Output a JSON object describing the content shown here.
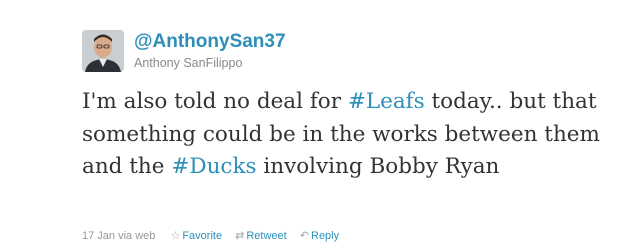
{
  "tweet": {
    "handle": "@AnthonySan37",
    "full_name": "Anthony SanFilippo",
    "avatar_icon": "profile-photo",
    "text_segments": [
      {
        "text": "I'm also told no deal for ",
        "hashtag": false
      },
      {
        "text": "#Leafs",
        "hashtag": true
      },
      {
        "text": " today.. but that something could be in the works between them and the ",
        "hashtag": false
      },
      {
        "text": "#Ducks",
        "hashtag": true
      },
      {
        "text": " involving Bobby Ryan",
        "hashtag": false
      }
    ],
    "timestamp": "17 Jan via web",
    "actions": {
      "favorite": {
        "label": "Favorite",
        "icon": "star-icon"
      },
      "retweet": {
        "label": "Retweet",
        "icon": "retweet-icon"
      },
      "reply": {
        "label": "Reply",
        "icon": "reply-icon"
      }
    }
  },
  "colors": {
    "link": "#2b8fb8",
    "text": "#333333",
    "muted": "#999999"
  }
}
